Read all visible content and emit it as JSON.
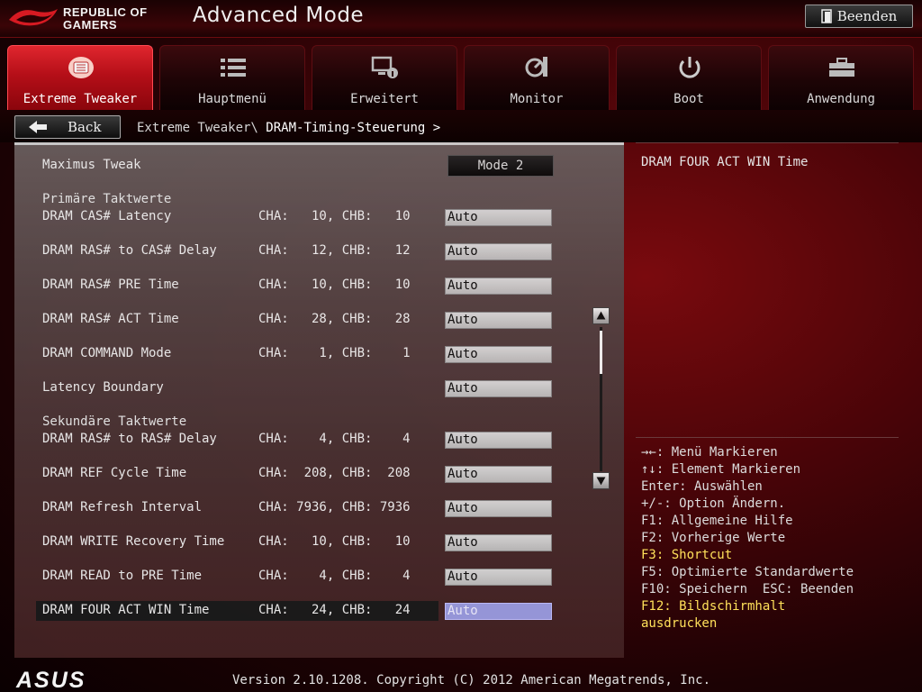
{
  "header": {
    "brand_line1": "REPUBLIC OF",
    "brand_line2": "GAMERS",
    "mode_title": "Advanced Mode",
    "exit_label": "Beenden"
  },
  "tabs": [
    {
      "label": "Extreme Tweaker",
      "icon": "tweaker-icon",
      "active": true
    },
    {
      "label": "Hauptmenü",
      "icon": "list-icon",
      "active": false
    },
    {
      "label": "Erweitert",
      "icon": "advanced-icon",
      "active": false
    },
    {
      "label": "Monitor",
      "icon": "monitor-icon",
      "active": false
    },
    {
      "label": "Boot",
      "icon": "power-icon",
      "active": false
    },
    {
      "label": "Anwendung",
      "icon": "tool-icon",
      "active": false
    }
  ],
  "nav": {
    "back_label": "Back",
    "breadcrumb_parent": "Extreme Tweaker\\",
    "breadcrumb_current": "DRAM-Timing-Steuerung >"
  },
  "settings": {
    "maximus_tweak": {
      "label": "Maximus Tweak",
      "value": "Mode 2"
    },
    "section_primary": "Primäre Taktwerte",
    "section_secondary": "Sekundäre Taktwerte",
    "rows": [
      {
        "name": "DRAM CAS# Latency",
        "cha": "CHA:   10, CHB:   10",
        "value": "Auto"
      },
      {
        "name": "DRAM RAS# to CAS# Delay",
        "cha": "CHA:   12, CHB:   12",
        "value": "Auto"
      },
      {
        "name": "DRAM RAS# PRE Time",
        "cha": "CHA:   10, CHB:   10",
        "value": "Auto"
      },
      {
        "name": "DRAM RAS# ACT Time",
        "cha": "CHA:   28, CHB:   28",
        "value": "Auto"
      },
      {
        "name": "DRAM COMMAND Mode",
        "cha": "CHA:    1, CHB:    1",
        "value": "Auto"
      },
      {
        "name": "Latency Boundary",
        "cha": "",
        "value": "Auto"
      },
      {
        "name": "DRAM RAS# to RAS# Delay",
        "cha": "CHA:    4, CHB:    4",
        "value": "Auto"
      },
      {
        "name": "DRAM REF Cycle Time",
        "cha": "CHA:  208, CHB:  208",
        "value": "Auto"
      },
      {
        "name": "DRAM Refresh Interval",
        "cha": "CHA: 7936, CHB: 7936",
        "value": "Auto"
      },
      {
        "name": "DRAM WRITE Recovery Time",
        "cha": "CHA:   10, CHB:   10",
        "value": "Auto"
      },
      {
        "name": "DRAM READ to PRE Time",
        "cha": "CHA:    4, CHB:    4",
        "value": "Auto"
      },
      {
        "name": "DRAM FOUR ACT WIN Time",
        "cha": "CHA:   24, CHB:   24",
        "value": "Auto"
      }
    ]
  },
  "help": {
    "title": "DRAM FOUR ACT WIN Time",
    "shortcuts": [
      {
        "text": "→←: Menü Markieren",
        "highlight": false
      },
      {
        "text": "↑↓: Element Markieren",
        "highlight": false
      },
      {
        "text": "Enter: Auswählen",
        "highlight": false
      },
      {
        "text": "+/-: Option Ändern.",
        "highlight": false
      },
      {
        "text": "F1: Allgemeine Hilfe",
        "highlight": false
      },
      {
        "text": "F2: Vorherige Werte",
        "highlight": false
      },
      {
        "text": "F3: Shortcut",
        "highlight": true
      },
      {
        "text": "F5: Optimierte Standardwerte",
        "highlight": false
      },
      {
        "text": "F10: Speichern  ESC: Beenden",
        "highlight": false
      },
      {
        "text": "F12: Bildschirmhalt",
        "highlight": true
      },
      {
        "text": "ausdrucken",
        "highlight": true
      }
    ]
  },
  "footer": {
    "brand": "ASUS",
    "version": "Version 2.10.1208. Copyright (C) 2012 American Megatrends, Inc."
  },
  "colors": {
    "accent_red": "#c8141c",
    "highlight_yellow": "#ffe15a",
    "selection": "#9a9be0"
  }
}
